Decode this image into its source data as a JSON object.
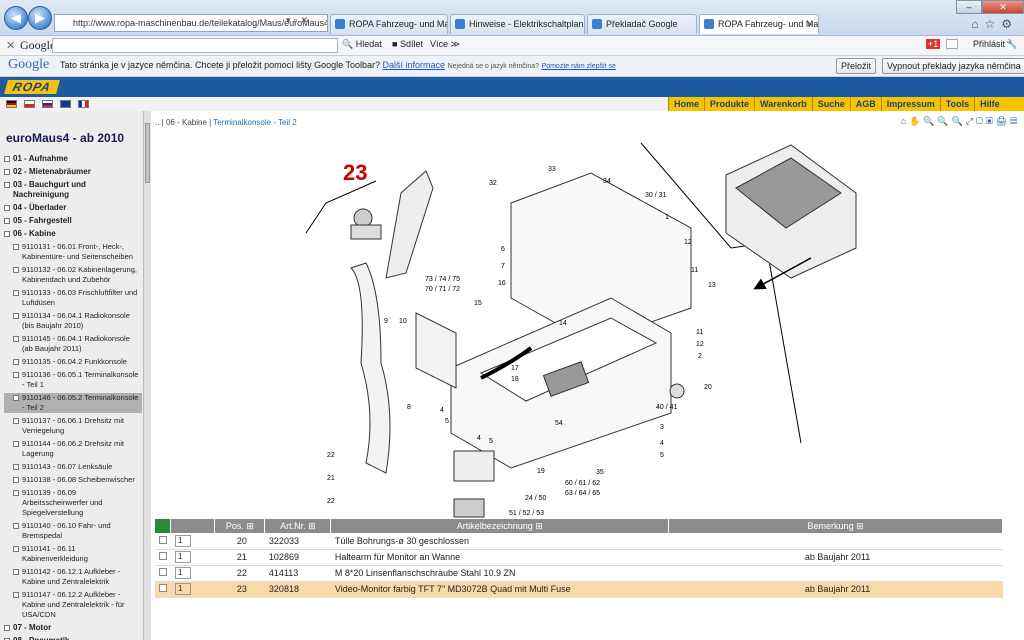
{
  "browser": {
    "url": "http://www.ropa-maschinenbau.de/teilekatalog/Maus/euroMaus4_ab",
    "tabs": [
      {
        "label": "ROPA Fahrzeug- und Maschin..."
      },
      {
        "label": "Hinweise - Elektrikschaltplan"
      },
      {
        "label": "Překladač Google"
      },
      {
        "label": "ROPA Fahrzeug- und Masc..."
      }
    ],
    "login": "Přihlásit"
  },
  "google_toolbar": {
    "logo": "Google",
    "hledat": "Hledat",
    "sdilet": "Sdílet",
    "vice": "Více ≫"
  },
  "translate_bar": {
    "message": "Tato stránka je v jazyce němčina. Chcete ji přeložit pomocí lišty Google Toolbar?",
    "more": "Další informace",
    "not_german": "Nejedná se o jazyk němčina?",
    "help": "Pomozte nám zlepšit se",
    "translate_btn": "Přeložit",
    "disable_btn": "Vypnout překlady jazyka němčina"
  },
  "ropa": {
    "logo": "ROPA"
  },
  "menu": [
    "Home",
    "Produkte",
    "Warenkorb",
    "Suche",
    "AGB",
    "Impressum",
    "Tools",
    "Hilfe"
  ],
  "sidebar": {
    "title": "euroMaus4 - ab 2010",
    "items": [
      {
        "label": "01 - Aufnahme",
        "level": 1
      },
      {
        "label": "02 - Mietenabräumer",
        "level": 1
      },
      {
        "label": "03 - Bauchgurt und Nachreinigung",
        "level": 1
      },
      {
        "label": "04 - Überlader",
        "level": 1
      },
      {
        "label": "05 - Fahrgestell",
        "level": 1
      },
      {
        "label": "06 - Kabine",
        "level": 1
      },
      {
        "label": "9110131 - 06.01 Front-, Heck-, Kabinentüre- und Seitenscheiben",
        "level": 2
      },
      {
        "label": "9110132 - 06.02 Kabinenlagerung, Kabinendach und Zubehör",
        "level": 2
      },
      {
        "label": "9110133 - 06.03 Frischluftfilter und Luftdüsen",
        "level": 2
      },
      {
        "label": "9110134 - 06.04.1 Radiokonsole (bis Baujahr 2010)",
        "level": 2
      },
      {
        "label": "9110145 - 06.04.1 Radiokonsole (ab Baujahr 2011)",
        "level": 2
      },
      {
        "label": "9110135 - 06.04.2 Funkkonsole",
        "level": 2
      },
      {
        "label": "9110136 - 06.05.1 Terminalkonsole - Teil 1",
        "level": 2
      },
      {
        "label": "9110146 - 06.05.2 Terminalkonsole - Teil 2",
        "level": 2,
        "selected": true
      },
      {
        "label": "9110137 - 06.06.1 Drehsitz mit Verriegelung",
        "level": 2
      },
      {
        "label": "9110144 - 06.06.2 Drehsitz mit Lagerung",
        "level": 2
      },
      {
        "label": "9110143 - 06.07 Lenksäule",
        "level": 2
      },
      {
        "label": "9110138 - 06.08 Scheibenwischer",
        "level": 2
      },
      {
        "label": "9110139 - 06.09 Arbeitsscheinwerfer und Spiegelverstellung",
        "level": 2
      },
      {
        "label": "9110140 - 06.10 Fahr- und Bremspedal",
        "level": 2
      },
      {
        "label": "9110141 - 06.11 Kabinenverkleidung",
        "level": 2
      },
      {
        "label": "9110142 - 06.12.1 Aufkleber - Kabine und Zentralelektrik",
        "level": 2
      },
      {
        "label": "9110147 - 06.12.2 Aufkleber - Kabine und Zentralelektrik - für USA/CDN",
        "level": 2
      },
      {
        "label": "07 - Motor",
        "level": 1
      },
      {
        "label": "08 - Pneumatik",
        "level": 1
      }
    ]
  },
  "breadcrumb": {
    "prefix": ".. | 06 - Kabine |",
    "current": "Terminalkonsole - Teil 2"
  },
  "diagram": {
    "big_label": "23",
    "labels": [
      "32",
      "33",
      "34",
      "30 / 31",
      "1",
      "12",
      "11",
      "13",
      "6",
      "7",
      "16",
      "73 / 74 / 75",
      "70 / 71 / 72",
      "15",
      "9",
      "10",
      "14",
      "11",
      "12",
      "2",
      "17",
      "18",
      "20",
      "8",
      "4",
      "5",
      "54",
      "40 / 41",
      "3",
      "4",
      "5",
      "4",
      "5",
      "19",
      "60 / 61 / 62",
      "63 / 64 / 65",
      "35",
      "22",
      "21",
      "22",
      "24 / 50",
      "51 / 52 / 53"
    ]
  },
  "table": {
    "headers": {
      "pos": "Pos.",
      "artnr": "Art.Nr.",
      "bez": "Artikelbezeichnung",
      "bem": "Bemerkung"
    },
    "rows": [
      {
        "qty": "1",
        "pos": "20",
        "artnr": "322033",
        "bez": "Tülle Bohrungs-ø 30 geschlossen",
        "bem": ""
      },
      {
        "qty": "1",
        "pos": "21",
        "artnr": "102869",
        "bez": "Haltearm für Monitor an Wanne",
        "bem": "ab Baujahr 2011"
      },
      {
        "qty": "1",
        "pos": "22",
        "artnr": "414113",
        "bez": "M 8*20 Linsenflanschschraube Stahl 10.9 ZN",
        "bem": ""
      },
      {
        "qty": "1",
        "pos": "23",
        "artnr": "320818",
        "bez": "Video-Monitor farbig TFT 7\" MD3072B Quad mit Multi Fuse",
        "bem": "ab Baujahr 2011",
        "highlight": true
      }
    ]
  }
}
